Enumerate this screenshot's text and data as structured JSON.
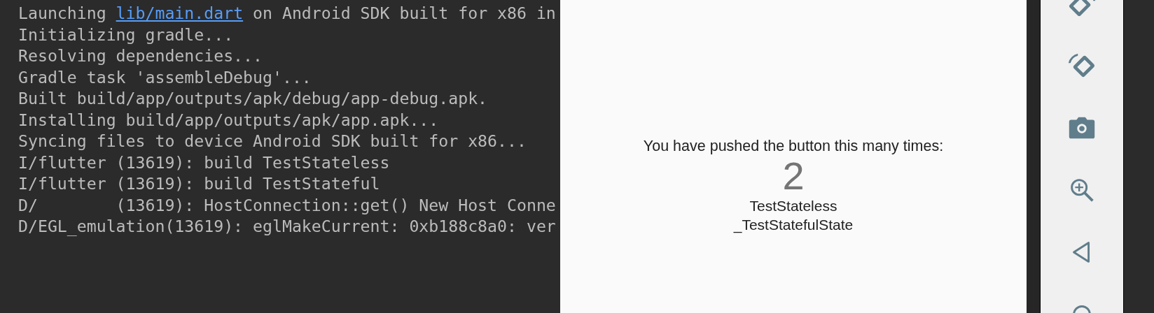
{
  "console": {
    "lines": [
      {
        "kind": "link",
        "before": "Launching ",
        "link": "lib/main.dart",
        "after": " on Android SDK built for x86 in"
      },
      {
        "kind": "plain",
        "text": "Initializing gradle..."
      },
      {
        "kind": "plain",
        "text": "Resolving dependencies..."
      },
      {
        "kind": "plain",
        "text": "Gradle task 'assembleDebug'..."
      },
      {
        "kind": "plain",
        "text": "Built build/app/outputs/apk/debug/app-debug.apk."
      },
      {
        "kind": "plain",
        "text": "Installing build/app/outputs/apk/app.apk..."
      },
      {
        "kind": "plain",
        "text": "Syncing files to device Android SDK built for x86..."
      },
      {
        "kind": "plain",
        "text": "I/flutter (13619): build TestStateless"
      },
      {
        "kind": "plain",
        "text": "I/flutter (13619): build TestStateful"
      },
      {
        "kind": "plain",
        "text": "D/        (13619): HostConnection::get() New Host Conne"
      },
      {
        "kind": "plain",
        "text": "D/EGL_emulation(13619): eglMakeCurrent: 0xb188c8a0: ver"
      }
    ]
  },
  "emulator": {
    "message": "You have pushed the button this many times:",
    "counter": "2",
    "labels": [
      "TestStateless",
      "_TestStatefulState"
    ]
  }
}
